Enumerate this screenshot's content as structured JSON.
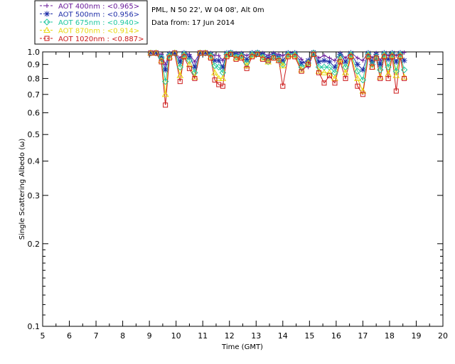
{
  "chart_data": {
    "type": "line",
    "xlabel": "Time (GMT)",
    "ylabel": "Single Scattering Albedo (ω)",
    "xlim": [
      5,
      20
    ],
    "ylim": [
      0.1,
      1.0
    ],
    "y_scale": "log",
    "x_ticks": [
      "5",
      "6",
      "7",
      "8",
      "9",
      "10",
      "11",
      "12",
      "13",
      "14",
      "15",
      "16",
      "17",
      "18",
      "19",
      "20"
    ],
    "y_ticks": [
      "0.1",
      "0.2",
      "0.3",
      "0.4",
      "0.5",
      "0.6",
      "0.7",
      "0.8",
      "0.9",
      "1.0"
    ],
    "x": [
      9.05,
      9.25,
      9.45,
      9.6,
      9.75,
      9.95,
      10.15,
      10.3,
      10.5,
      10.7,
      10.9,
      11.1,
      11.3,
      11.45,
      11.6,
      11.75,
      11.9,
      12.05,
      12.25,
      12.45,
      12.65,
      12.85,
      13.05,
      13.25,
      13.45,
      13.65,
      13.85,
      14.0,
      14.2,
      14.45,
      14.7,
      14.95,
      15.15,
      15.35,
      15.55,
      15.75,
      15.95,
      16.15,
      16.35,
      16.55,
      16.8,
      17.0,
      17.2,
      17.35,
      17.5,
      17.65,
      17.8,
      17.95,
      18.1,
      18.25,
      18.4,
      18.55
    ],
    "series": [
      {
        "name": "AOT  400nm : <0.965>",
        "color": "#6a1a9a",
        "marker": "plus",
        "values": [
          0.995,
          0.995,
          0.98,
          0.9,
          0.99,
          0.995,
          0.95,
          0.995,
          0.98,
          0.92,
          0.995,
          0.995,
          0.99,
          0.97,
          0.97,
          0.93,
          0.995,
          0.995,
          0.99,
          0.99,
          0.97,
          0.995,
          0.995,
          0.99,
          0.97,
          0.99,
          0.98,
          0.97,
          0.995,
          0.995,
          0.94,
          0.88,
          0.995,
          0.95,
          0.97,
          0.95,
          0.93,
          0.99,
          0.95,
          0.995,
          0.95,
          0.93,
          0.995,
          0.95,
          0.99,
          0.93,
          0.995,
          0.97,
          0.995,
          0.97,
          0.995,
          0.995
        ]
      },
      {
        "name": "AOT  500nm : <0.956>",
        "color": "#1e2ea8",
        "marker": "star",
        "values": [
          0.995,
          0.995,
          0.96,
          0.86,
          0.98,
          0.995,
          0.92,
          0.99,
          0.96,
          0.88,
          0.995,
          0.995,
          0.98,
          0.93,
          0.93,
          0.88,
          0.99,
          0.995,
          0.98,
          0.98,
          0.94,
          0.99,
          0.995,
          0.98,
          0.95,
          0.98,
          0.96,
          0.93,
          0.99,
          0.99,
          0.91,
          0.93,
          0.995,
          0.92,
          0.93,
          0.92,
          0.88,
          0.98,
          0.92,
          0.99,
          0.9,
          0.86,
          0.99,
          0.92,
          0.98,
          0.9,
          0.99,
          0.94,
          0.99,
          0.92,
          0.99,
          0.93
        ]
      },
      {
        "name": "AOT  675nm : <0.940>",
        "color": "#20c8a0",
        "marker": "diamond",
        "values": [
          0.99,
          0.99,
          0.95,
          0.78,
          0.97,
          0.99,
          0.88,
          0.98,
          0.93,
          0.84,
          0.99,
          0.99,
          0.97,
          0.89,
          0.88,
          0.84,
          0.98,
          0.99,
          0.96,
          0.97,
          0.91,
          0.98,
          0.99,
          0.96,
          0.92,
          0.96,
          0.94,
          0.9,
          0.98,
          0.98,
          0.88,
          0.91,
          0.99,
          0.88,
          0.88,
          0.88,
          0.84,
          0.96,
          0.88,
          0.98,
          0.85,
          0.79,
          0.98,
          0.9,
          0.96,
          0.86,
          0.98,
          0.88,
          0.98,
          0.85,
          0.98,
          0.86
        ]
      },
      {
        "name": "AOT  870nm : <0.914>",
        "color": "#e8d810",
        "marker": "triangle",
        "values": [
          0.99,
          0.99,
          0.93,
          0.7,
          0.96,
          0.99,
          0.82,
          0.97,
          0.9,
          0.81,
          0.99,
          0.99,
          0.96,
          0.84,
          0.8,
          0.8,
          0.97,
          0.98,
          0.95,
          0.96,
          0.89,
          0.97,
          0.98,
          0.95,
          0.92,
          0.95,
          0.93,
          0.89,
          0.97,
          0.97,
          0.86,
          0.91,
          0.98,
          0.85,
          0.84,
          0.84,
          0.8,
          0.94,
          0.84,
          0.97,
          0.8,
          0.72,
          0.97,
          0.88,
          0.95,
          0.81,
          0.97,
          0.83,
          0.97,
          0.82,
          0.97,
          0.81
        ]
      },
      {
        "name": "AOT 1020nm : <0.887>",
        "color": "#cc1a1a",
        "marker": "square",
        "values": [
          0.99,
          0.99,
          0.92,
          0.64,
          0.95,
          0.99,
          0.78,
          0.96,
          0.87,
          0.8,
          0.99,
          0.99,
          0.95,
          0.79,
          0.76,
          0.75,
          0.96,
          0.98,
          0.94,
          0.95,
          0.87,
          0.96,
          0.98,
          0.94,
          0.93,
          0.95,
          0.93,
          0.75,
          0.96,
          0.96,
          0.85,
          0.9,
          0.98,
          0.84,
          0.77,
          0.82,
          0.77,
          0.92,
          0.8,
          0.96,
          0.75,
          0.7,
          0.96,
          0.88,
          0.95,
          0.8,
          0.96,
          0.8,
          0.96,
          0.72,
          0.96,
          0.8
        ]
      }
    ]
  },
  "info": {
    "location": "PML, N 50 22', W 04 08', Alt 0m",
    "date": "Data from: 17 Jun 2014"
  }
}
